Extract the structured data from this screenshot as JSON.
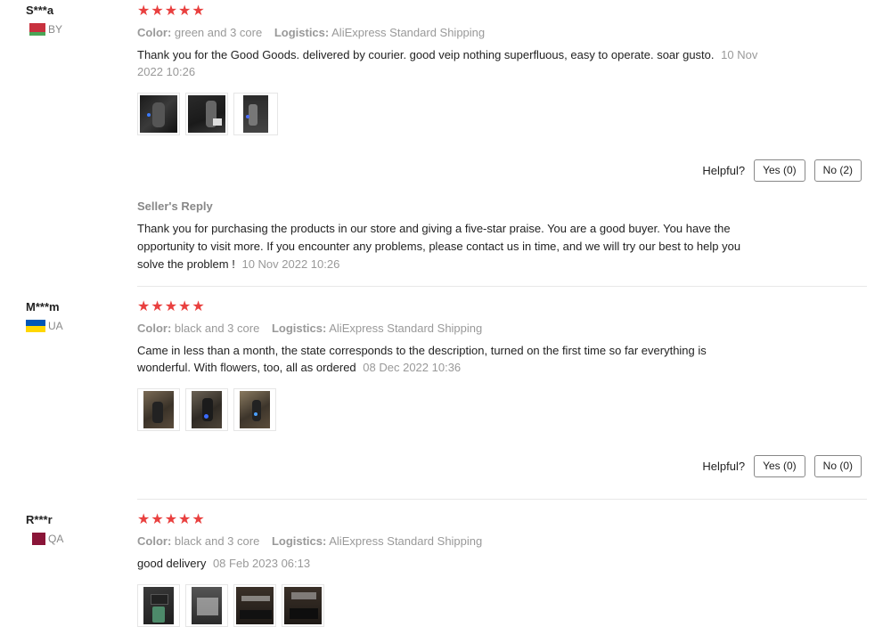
{
  "reviews": [
    {
      "user": "S***a",
      "country_code": "BY",
      "stars": "★★★★★",
      "color_label": "Color:",
      "color_value": "green and 3 core",
      "logistics_label": "Logistics:",
      "logistics_value": "AliExpress Standard Shipping",
      "text": "Thank you for the Good Goods. delivered by courier. good veip nothing superfluous, easy to operate. soar gusto.",
      "date": "10 Nov 2022 10:26",
      "helpful_label": "Helpful?",
      "yes_label": "Yes (0)",
      "no_label": "No (2)",
      "seller_reply_title": "Seller's Reply",
      "seller_reply_text": "Thank you for purchasing the products in our store and giving a five-star praise. You are a good buyer. You have the opportunity to visit more. If you encounter any problems, please contact us in time, and we will try our best to help you solve the problem !",
      "seller_reply_date": "10 Nov 2022 10:26"
    },
    {
      "user": "M***m",
      "country_code": "UA",
      "stars": "★★★★★",
      "color_label": "Color:",
      "color_value": "black and 3 core",
      "logistics_label": "Logistics:",
      "logistics_value": "AliExpress Standard Shipping",
      "text": "Came in less than a month, the state corresponds to the description, turned on the first time so far everything is wonderful. With flowers, too, all as ordered",
      "date": "08 Dec 2022 10:36",
      "helpful_label": "Helpful?",
      "yes_label": "Yes (0)",
      "no_label": "No (0)"
    },
    {
      "user": "R***r",
      "country_code": "QA",
      "stars": "★★★★★",
      "color_label": "Color:",
      "color_value": "black and 3 core",
      "logistics_label": "Logistics:",
      "logistics_value": "AliExpress Standard Shipping",
      "text": "good delivery",
      "date": "08 Feb 2023 06:13"
    }
  ],
  "colors": {
    "star": "#e9403f",
    "muted": "#999999",
    "divider": "#e8e8e8"
  }
}
